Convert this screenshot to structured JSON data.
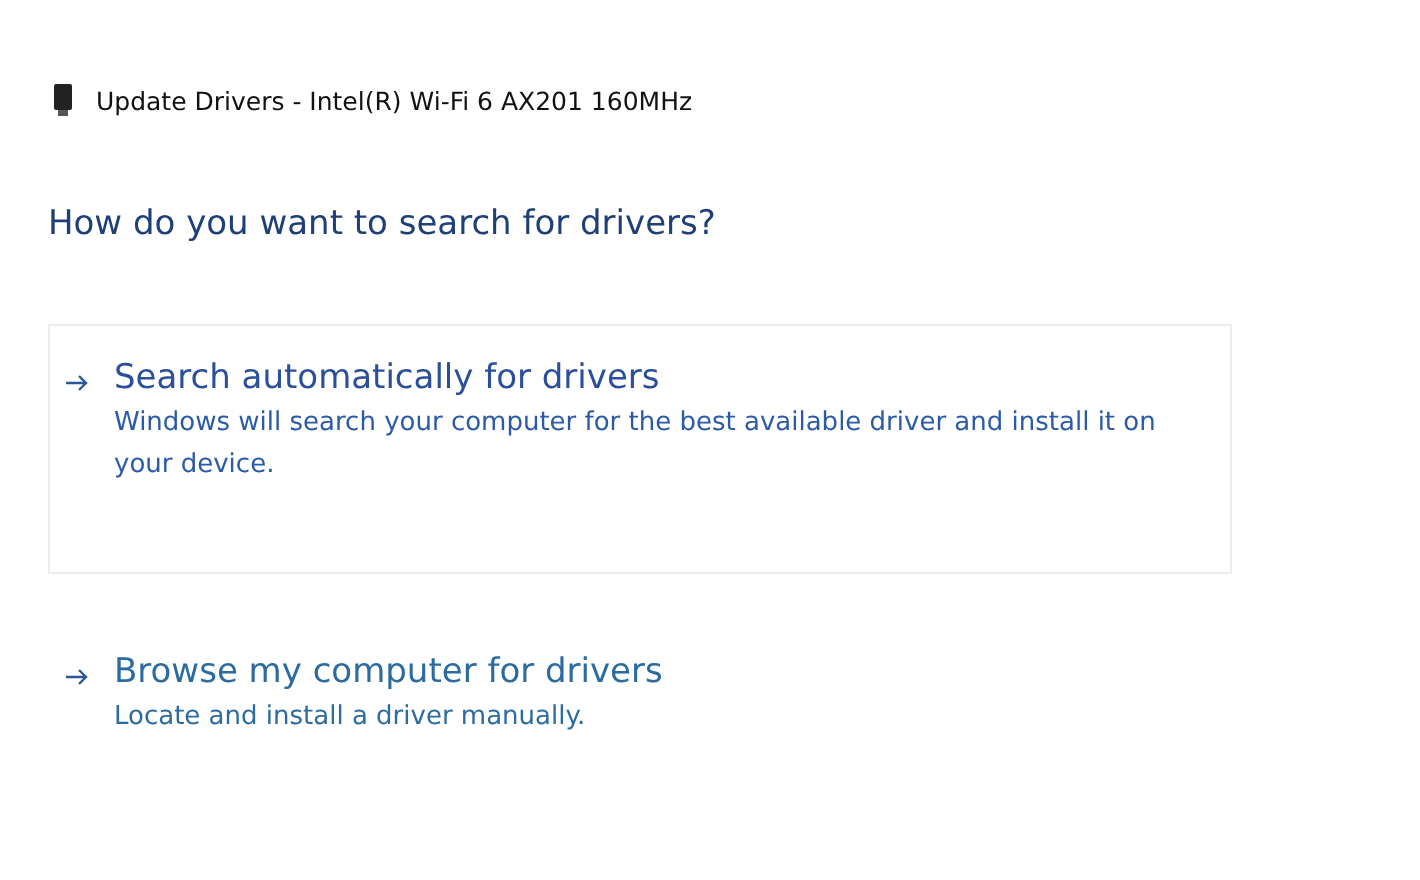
{
  "window": {
    "title": "Update Drivers - Intel(R) Wi-Fi 6 AX201 160MHz"
  },
  "heading": "How do you want to search for drivers?",
  "options": [
    {
      "title": "Search automatically for drivers",
      "description": "Windows will search your computer for the best available driver and install it on your device.",
      "selected": true
    },
    {
      "title": "Browse my computer for drivers",
      "description": "Locate and install a driver manually.",
      "selected": false
    }
  ]
}
